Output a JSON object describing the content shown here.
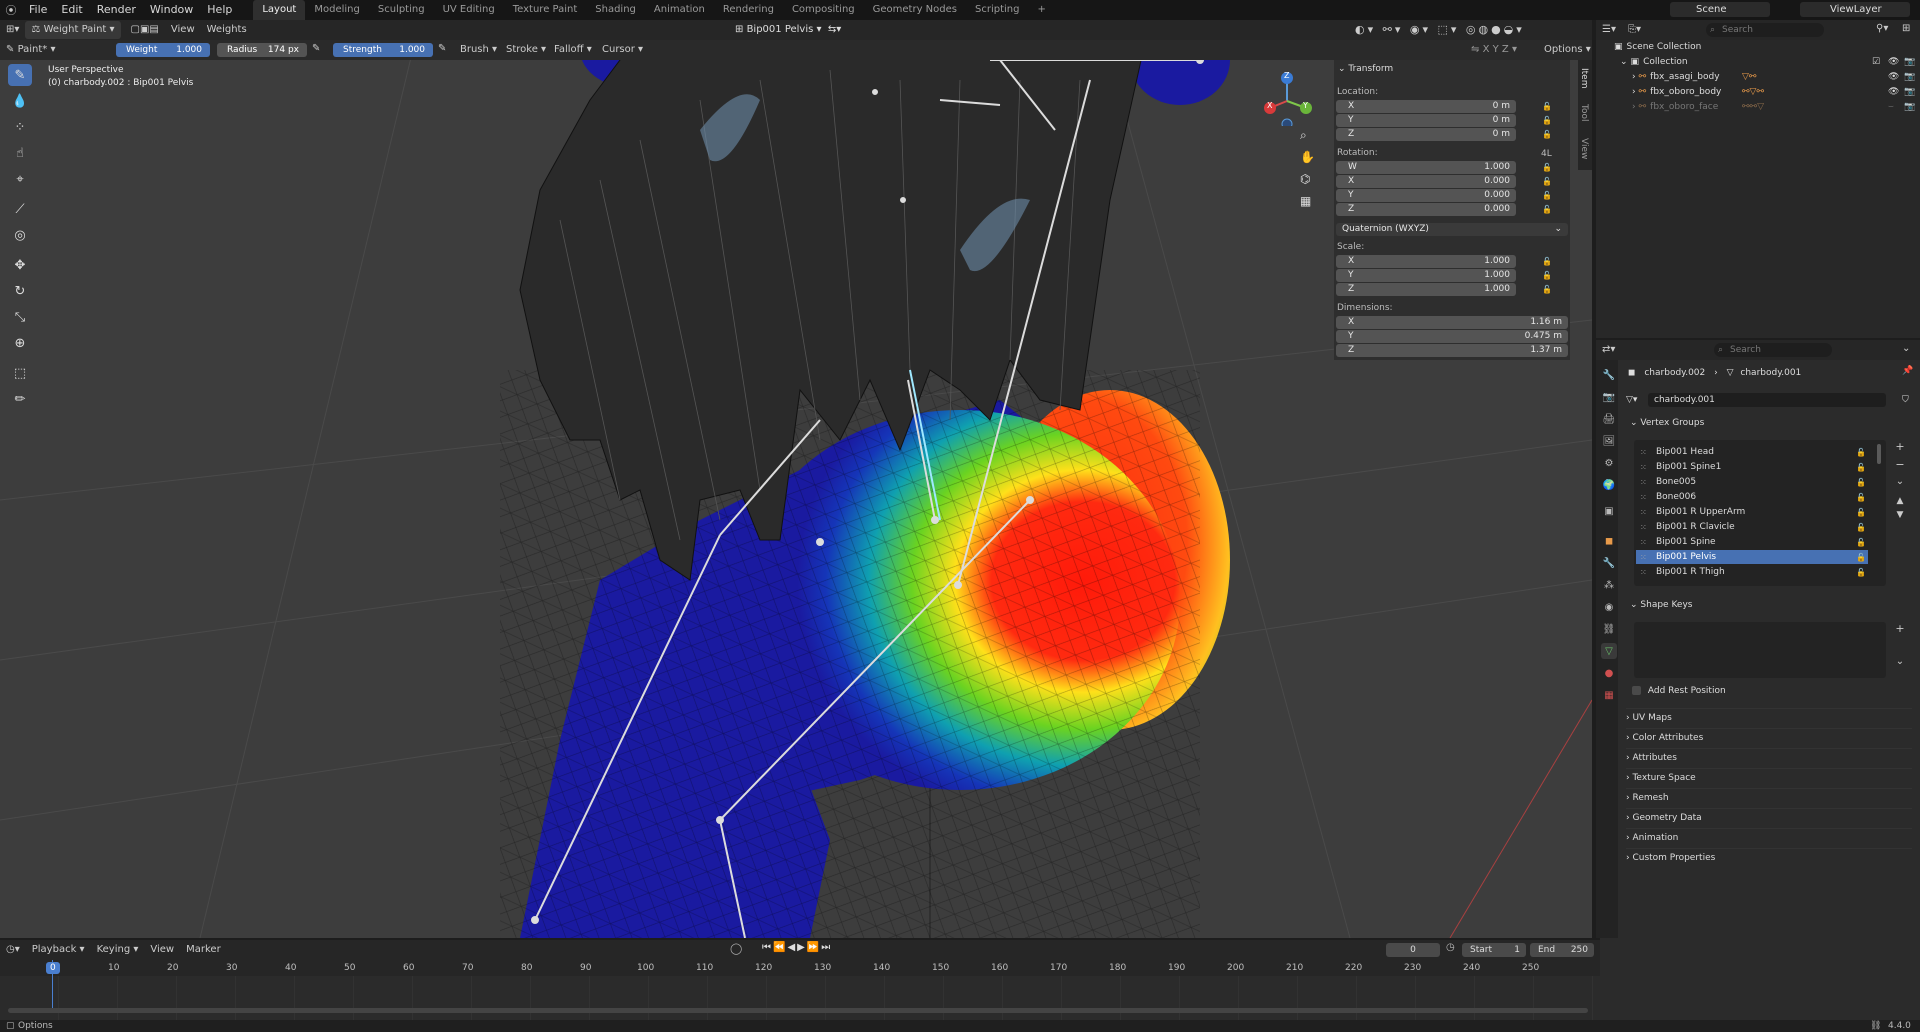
{
  "topbar": {
    "menus": [
      "File",
      "Edit",
      "Render",
      "Window",
      "Help"
    ],
    "workspaces": [
      "Layout",
      "Modeling",
      "Sculpting",
      "UV Editing",
      "Texture Paint",
      "Shading",
      "Animation",
      "Rendering",
      "Compositing",
      "Geometry Nodes",
      "Scripting",
      "+"
    ],
    "active_workspace": "Layout",
    "scene_label": "Scene",
    "viewlayer_label": "ViewLayer"
  },
  "viewport_header": {
    "mode": "Weight Paint",
    "menus": [
      "View",
      "Weights"
    ],
    "active_group": "Bip001 Pelvis",
    "brush_name": "Paint*",
    "weight_label": "Weight",
    "weight_value": "1.000",
    "radius_label": "Radius",
    "radius_value": "174 px",
    "strength_label": "Strength",
    "strength_value": "1.000",
    "dropdowns": [
      "Brush",
      "Stroke",
      "Falloff",
      "Cursor"
    ],
    "options_label": "Options",
    "axes_labels": [
      "X",
      "Y",
      "Z"
    ]
  },
  "viewport": {
    "perspective_label": "User Perspective",
    "object_label": "(0) charbody.002 : Bip001 Pelvis",
    "gizmo": {
      "x": "X",
      "y": "Y",
      "z": "Z"
    }
  },
  "npanel": {
    "section_title": "Transform",
    "location_label": "Location:",
    "location": [
      {
        "axis": "X",
        "value": "0 m"
      },
      {
        "axis": "Y",
        "value": "0 m"
      },
      {
        "axis": "Z",
        "value": "0 m"
      }
    ],
    "rotation_label": "Rotation:",
    "rotation_mode_short": "4L",
    "rotation": [
      {
        "axis": "W",
        "value": "1.000"
      },
      {
        "axis": "X",
        "value": "0.000"
      },
      {
        "axis": "Y",
        "value": "0.000"
      },
      {
        "axis": "Z",
        "value": "0.000"
      }
    ],
    "rotation_mode": "Quaternion (WXYZ)",
    "scale_label": "Scale:",
    "scale": [
      {
        "axis": "X",
        "value": "1.000"
      },
      {
        "axis": "Y",
        "value": "1.000"
      },
      {
        "axis": "Z",
        "value": "1.000"
      }
    ],
    "dimensions_label": "Dimensions:",
    "dimensions": [
      {
        "axis": "X",
        "value": "1.16 m"
      },
      {
        "axis": "Y",
        "value": "0.475 m"
      },
      {
        "axis": "Z",
        "value": "1.37 m"
      }
    ],
    "side_tabs": [
      "Item",
      "Tool",
      "View"
    ]
  },
  "outliner": {
    "search_placeholder": "Search",
    "scene_collection": "Scene Collection",
    "collection": "Collection",
    "items": [
      "fbx_asagi_body",
      "fbx_oboro_body",
      "fbx_oboro_face"
    ]
  },
  "properties": {
    "search_placeholder": "Search",
    "breadcrumb_object": "charbody.002",
    "breadcrumb_data": "charbody.001",
    "data_name": "charbody.001",
    "vertex_groups_title": "Vertex Groups",
    "vertex_groups": [
      "Bip001 Head",
      "Bip001 Spine1",
      "Bone005",
      "Bone006",
      "Bip001 R UpperArm",
      "Bip001 R Clavicle",
      "Bip001 Spine",
      "Bip001 Pelvis",
      "Bip001 R Thigh"
    ],
    "selected_group": "Bip001 Pelvis",
    "shape_keys_title": "Shape Keys",
    "add_rest_position": "Add Rest Position",
    "collapsed_panels": [
      "UV Maps",
      "Color Attributes",
      "Attributes",
      "Texture Space",
      "Remesh",
      "Geometry Data",
      "Animation",
      "Custom Properties"
    ]
  },
  "timeline": {
    "menus": [
      "Playback",
      "Keying",
      "View",
      "Marker"
    ],
    "current_frame": "0",
    "start_label": "Start",
    "start_value": "1",
    "end_label": "End",
    "end_value": "250",
    "ticks": [
      "0",
      "10",
      "20",
      "30",
      "40",
      "50",
      "60",
      "70",
      "80",
      "90",
      "100",
      "110",
      "120",
      "130",
      "140",
      "150",
      "160",
      "170",
      "180",
      "190",
      "200",
      "210",
      "220",
      "230",
      "240",
      "250"
    ]
  },
  "statusbar": {
    "left": "Options",
    "version": "4.4.0"
  },
  "colors": {
    "accent": "#4771b3",
    "panel_bg": "#303030",
    "viewport_bg": "#3d3d3d"
  }
}
